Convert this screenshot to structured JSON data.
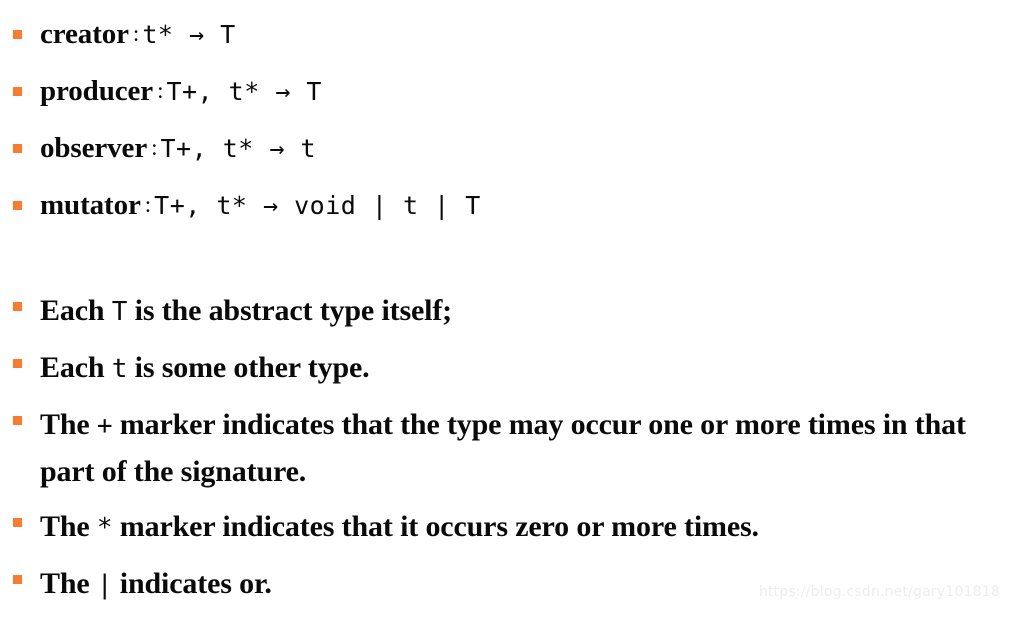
{
  "slide": {
    "background_color": "#ffffff",
    "text_color": "#0a0a0a",
    "bullet_color": "#f97b30"
  },
  "signatures": [
    {
      "name": "creator",
      "separator": ":",
      "type": "t* → T"
    },
    {
      "name": "producer",
      "separator": ":",
      "type": "T+, t* → T"
    },
    {
      "name": "observer",
      "separator": ":",
      "type": "T+, t* → t"
    },
    {
      "name": "mutator",
      "separator": ":",
      "type": "T+, t* → void | t | T"
    }
  ],
  "notes": [
    {
      "pre": "Each ",
      "mono": "T",
      "post": " is the abstract type itself;"
    },
    {
      "pre": "Each ",
      "mono": "t",
      "post": " is some other type."
    },
    {
      "pre": "The ",
      "mono": "+",
      "post": " marker indicates that the type may occur one or more times in that part of the signature."
    },
    {
      "pre": "The ",
      "mono": "*",
      "post": " marker indicates that it occurs zero or more times."
    },
    {
      "pre": "The ",
      "mono": "|",
      "post": " indicates or."
    }
  ],
  "watermark": {
    "url": "https://blog.csdn.net/gary101818"
  }
}
